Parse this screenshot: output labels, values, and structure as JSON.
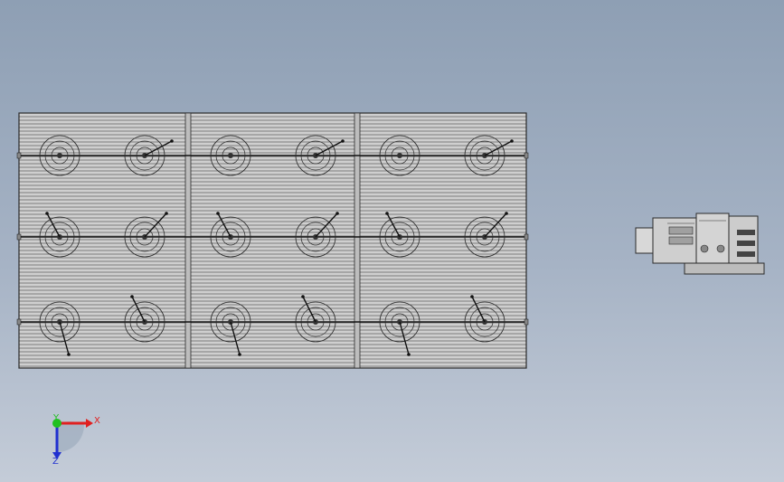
{
  "viewport": {
    "background_top": "#8e9fb4",
    "background_bottom": "#c4ccd8"
  },
  "model": {
    "panel_fill": "#cfcfcf",
    "line_color": "#2a2a2a",
    "panel_grid": {
      "columns": 3,
      "rows": 3,
      "fixtures_per_cell": 2
    }
  },
  "triad": {
    "x_label": "X",
    "y_label": "Y",
    "z_label": "Z",
    "x_color": "#e02020",
    "y_color": "#20c020",
    "z_color": "#2030d0"
  }
}
